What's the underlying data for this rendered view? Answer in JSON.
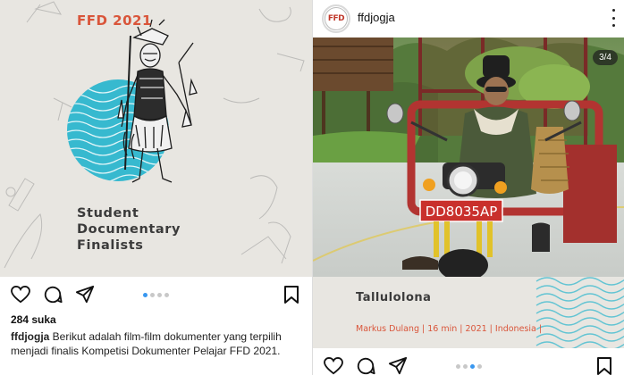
{
  "left_post": {
    "poster": {
      "title": "FFD 2021",
      "caption_lines": [
        "Student",
        "Documentary",
        "Finalists"
      ]
    },
    "likes": "284 suka",
    "caption_user": "ffdjogja",
    "caption_body": " Berikut adalah film-film dokumenter yang terpilih menjadi finalis Kompetisi Dokumenter Pelajar FFD 2021.",
    "carousel": {
      "count": 4,
      "active": 1
    }
  },
  "right_post": {
    "username": "ffdjogja",
    "avatar_text": "FFD",
    "counter": "3/4",
    "photo": {
      "plate": "DD8035AP"
    },
    "film_title": "Tallulolona",
    "film_meta": "Markus Dulang | 16 min | 2021 | Indonesia |",
    "carousel": {
      "count": 4,
      "active": 3
    }
  },
  "colors": {
    "accent": "#d9553a",
    "poster_bg": "#e8e6e1",
    "cyan": "#37b9cf",
    "active_dot": "#3897f0"
  },
  "icons": [
    "heart-icon",
    "comment-icon",
    "share-icon",
    "bookmark-icon",
    "more-icon"
  ]
}
